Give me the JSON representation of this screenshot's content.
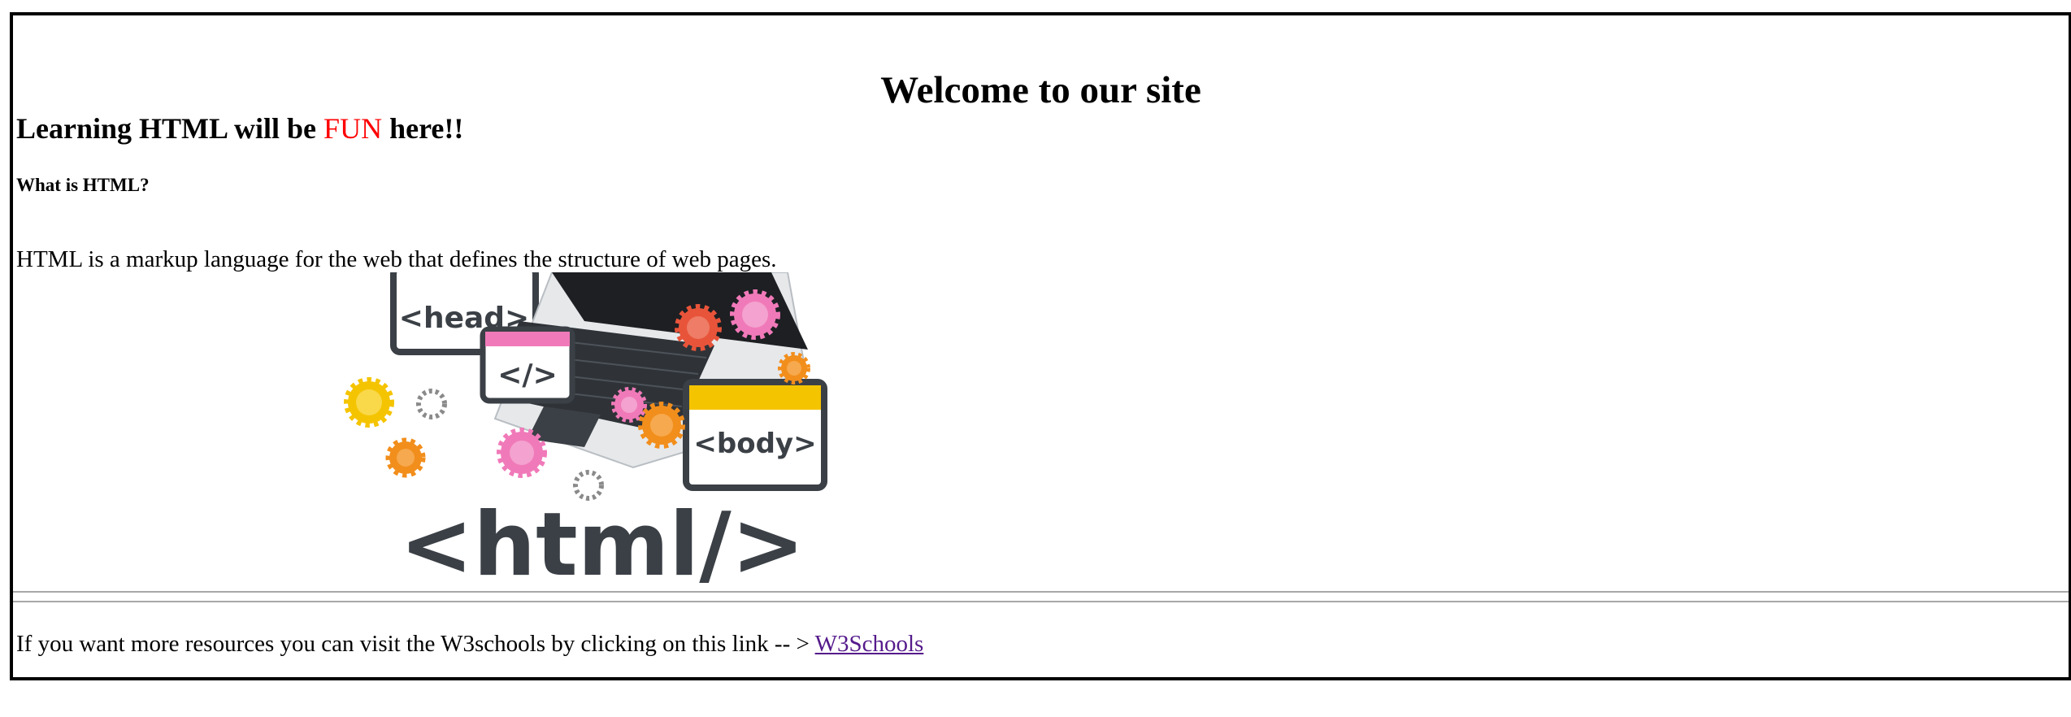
{
  "page": {
    "heading": "Welcome to our site",
    "subheading": {
      "before": "Learning HTML will be ",
      "highlight": "FUN",
      "after": " here!!"
    },
    "question": "What is HTML?",
    "description": "HTML is a markup language for the web that defines the structure of web pages.",
    "illustration": {
      "tags": [
        "<head>",
        "</>",
        "<body>",
        "<html/>"
      ],
      "colors": {
        "dark": "#3b4046",
        "pink": "#f07ab9",
        "yellow": "#f5c400",
        "orange": "#f28e1c",
        "red": "#e8543a",
        "gray": "#8a8a8a"
      }
    },
    "footer": {
      "text": "If you want more resources you can visit the W3schools by clicking on this link -- > ",
      "link_label": "W3Schools"
    },
    "highlight_color": "#ff0000",
    "link_color": "#551a8b"
  }
}
